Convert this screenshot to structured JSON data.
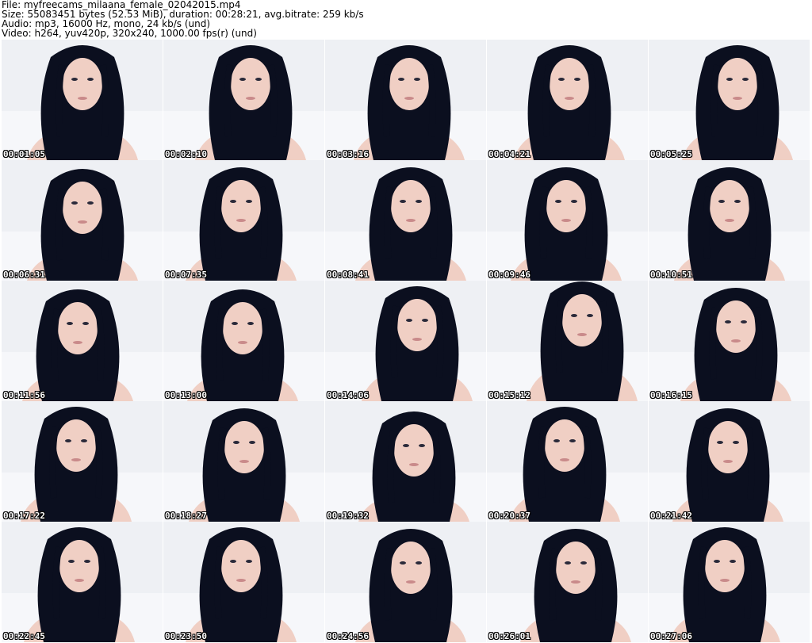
{
  "header": {
    "file": "File: myfreecams_milaana_female_02042015.mp4",
    "size": "Size: 55083451 bytes (52.53 MiB), duration: 00:28:21, avg.bitrate: 259 kb/s",
    "audio": "Audio: mp3, 16000 Hz, mono, 24 kb/s (und)",
    "video": "Video: h264, yuv420p, 320x240, 1000.00 fps(r) (und)"
  },
  "thumbnails": [
    {
      "timestamp": "00:01:05"
    },
    {
      "timestamp": "00:02:10"
    },
    {
      "timestamp": "00:03:16"
    },
    {
      "timestamp": "00:04:21"
    },
    {
      "timestamp": "00:05:25"
    },
    {
      "timestamp": "00:06:31"
    },
    {
      "timestamp": "00:07:35"
    },
    {
      "timestamp": "00:08:41"
    },
    {
      "timestamp": "00:09:46"
    },
    {
      "timestamp": "00:10:51"
    },
    {
      "timestamp": "00:11:56"
    },
    {
      "timestamp": "00:13:00"
    },
    {
      "timestamp": "00:14:06"
    },
    {
      "timestamp": "00:15:12"
    },
    {
      "timestamp": "00:16:15"
    },
    {
      "timestamp": "00:17:22"
    },
    {
      "timestamp": "00:18:27"
    },
    {
      "timestamp": "00:19:32"
    },
    {
      "timestamp": "00:20:37"
    },
    {
      "timestamp": "00:21:42"
    },
    {
      "timestamp": "00:22:45"
    },
    {
      "timestamp": "00:23:50"
    },
    {
      "timestamp": "00:24:56"
    },
    {
      "timestamp": "00:26:01"
    },
    {
      "timestamp": "00:27:06"
    }
  ],
  "colors": {
    "background": "#ffffff",
    "wall": "#eef0f4",
    "hair": "#0b0f1f",
    "skin": "#f0cfc4",
    "top": "#141420"
  }
}
